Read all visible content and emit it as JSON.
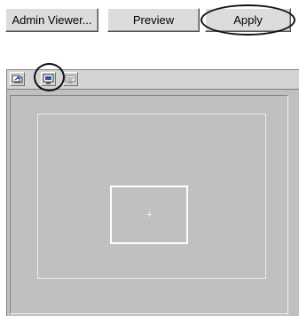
{
  "buttons": {
    "admin_viewer": "Admin Viewer...",
    "preview": "Preview",
    "apply": "Apply"
  },
  "toolbar": {
    "icons": [
      "refresh-view-icon",
      "screen-view-icon",
      "slideshow-icon"
    ]
  },
  "colors": {
    "panel_background": "#c0c0c0",
    "frame_line": "#ffffff",
    "highlight_ring": "#111111"
  }
}
